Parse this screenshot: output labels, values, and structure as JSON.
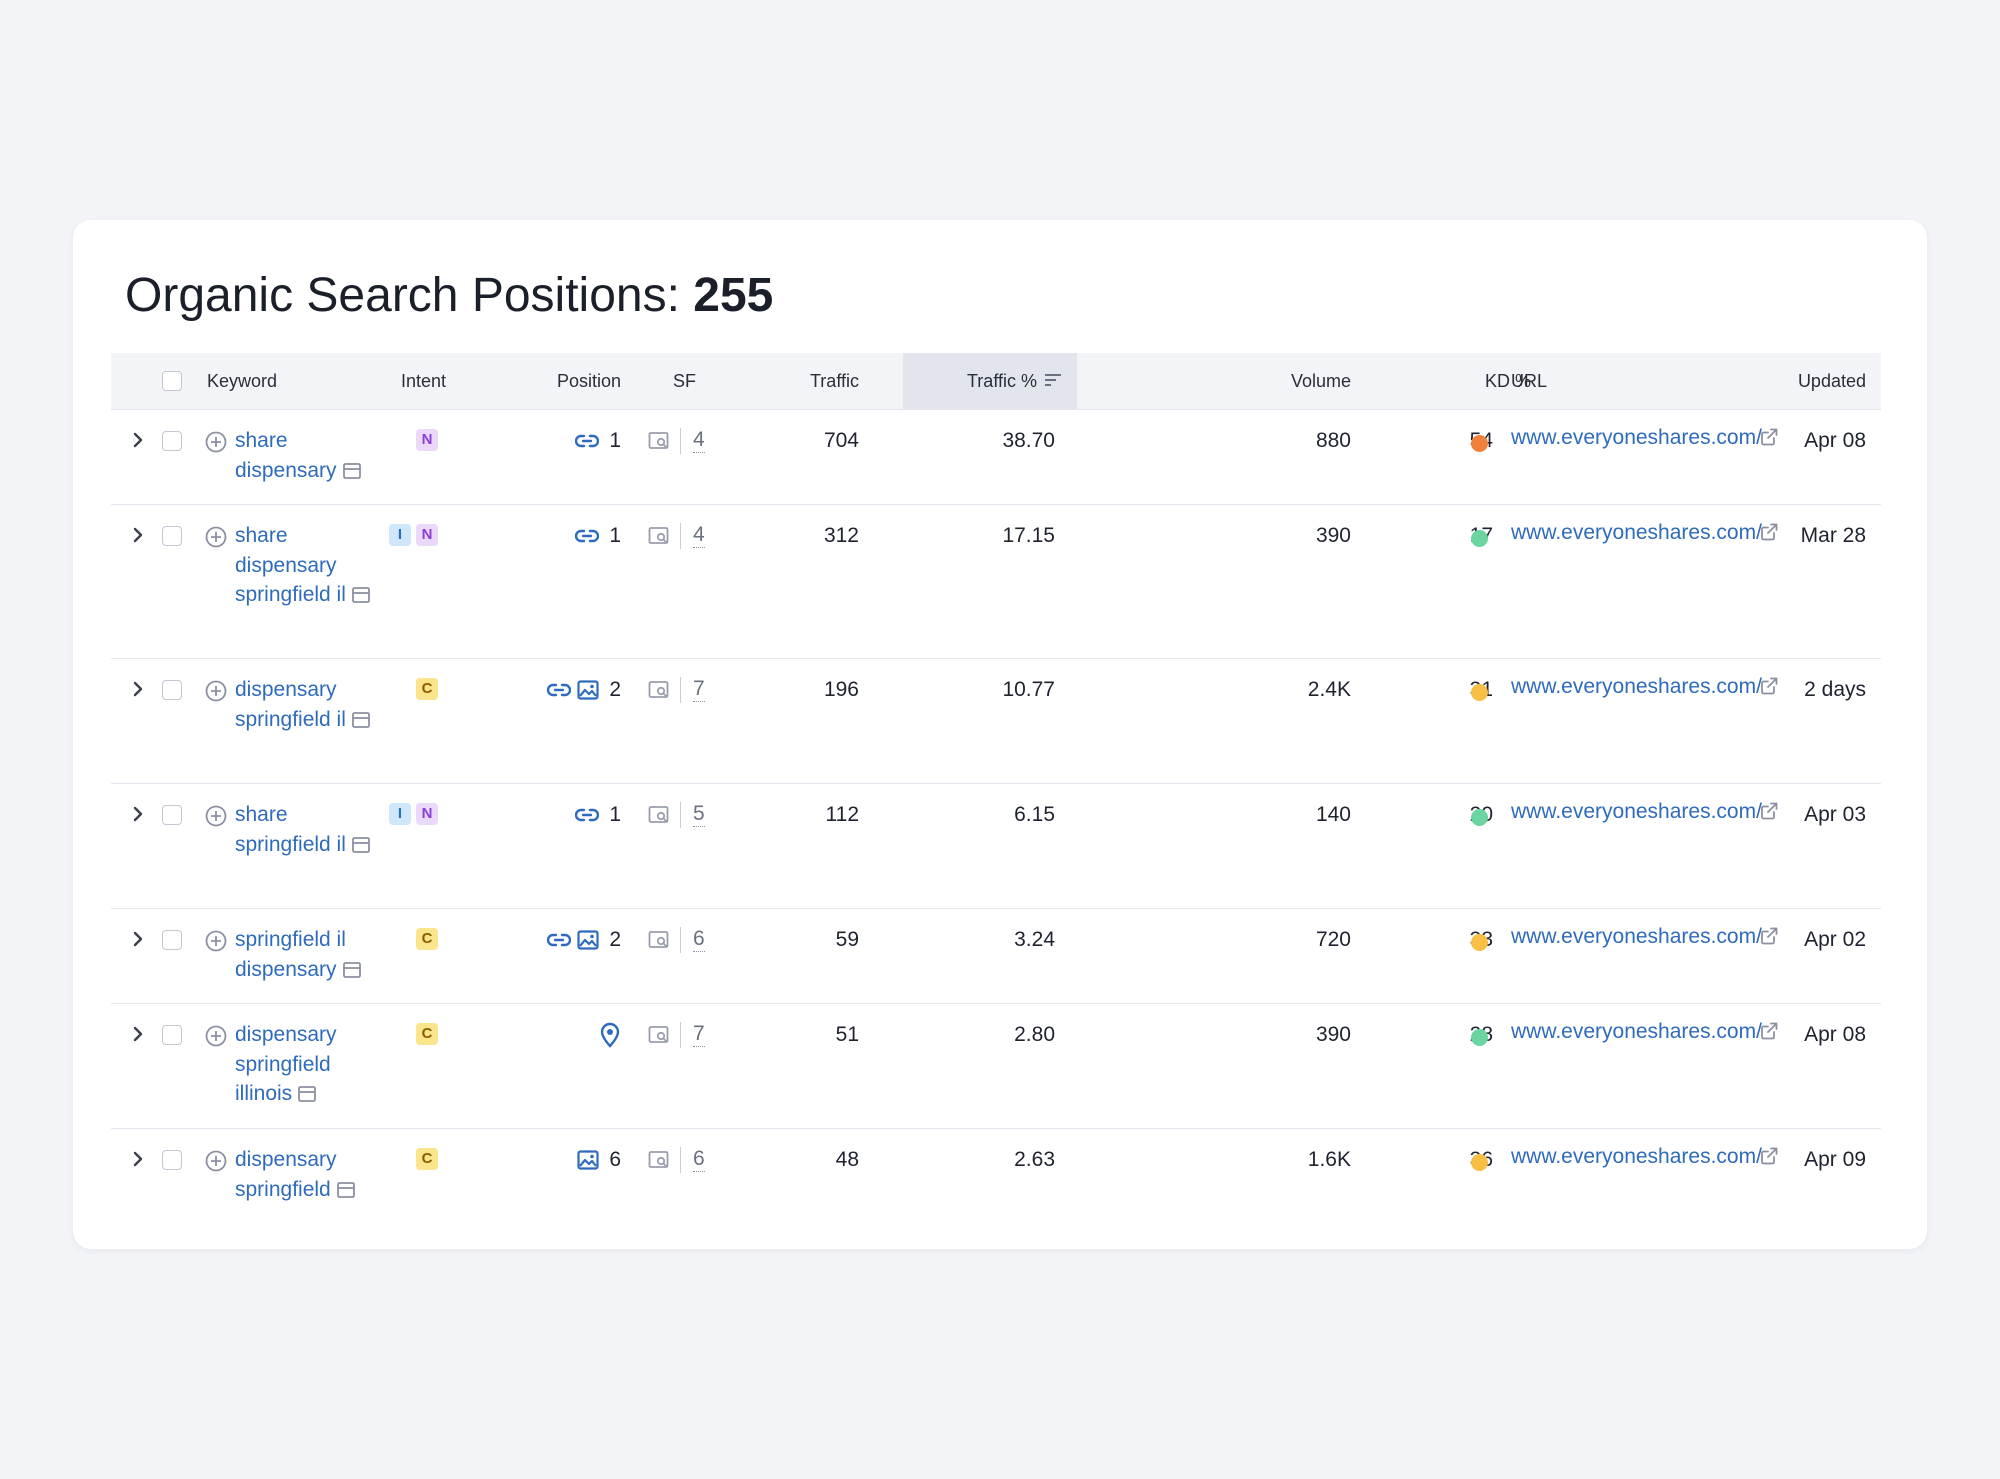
{
  "title": {
    "text": "Organic Search Positions: ",
    "count": "255"
  },
  "columns": {
    "keyword": "Keyword",
    "intent": "Intent",
    "position": "Position",
    "sf": "SF",
    "traffic": "Traffic",
    "traffic_pct": "Traffic %",
    "volume": "Volume",
    "kd": "KD %",
    "url": "URL",
    "updated": "Updated"
  },
  "kd_colors": {
    "orange": "#f0803c",
    "green": "#6ad5a0",
    "yellow": "#f7c044"
  },
  "rows": [
    {
      "keyword": "share dispensary",
      "intent": [
        "N"
      ],
      "position_icons": [
        "link-icon"
      ],
      "position": "1",
      "sf": "4",
      "traffic": "704",
      "traffic_pct": "38.70",
      "volume": "880",
      "kd": "54",
      "kd_color": "#f0803c",
      "url": "www.everyoneshares.com/",
      "updated": "Apr 08"
    },
    {
      "keyword": "share dispensary springfield il",
      "intent": [
        "I",
        "N"
      ],
      "position_icons": [
        "link-icon"
      ],
      "position": "1",
      "sf": "4",
      "traffic": "312",
      "traffic_pct": "17.15",
      "volume": "390",
      "kd": "17",
      "kd_color": "#6ad5a0",
      "url": "www.everyoneshares.com/",
      "updated": "Mar 28"
    },
    {
      "keyword": "dispensary springfield il",
      "intent": [
        "C"
      ],
      "position_icons": [
        "link-icon",
        "image-icon"
      ],
      "position": "2",
      "sf": "7",
      "traffic": "196",
      "traffic_pct": "10.77",
      "volume": "2.4K",
      "kd": "31",
      "kd_color": "#f7c044",
      "url": "www.everyoneshares.com/",
      "updated": "2 days"
    },
    {
      "keyword": "share springfield il",
      "intent": [
        "I",
        "N"
      ],
      "position_icons": [
        "link-icon"
      ],
      "position": "1",
      "sf": "5",
      "traffic": "112",
      "traffic_pct": "6.15",
      "volume": "140",
      "kd": "20",
      "kd_color": "#6ad5a0",
      "url": "www.everyoneshares.com/",
      "updated": "Apr 03"
    },
    {
      "keyword": "springfield il dispensary",
      "intent": [
        "C"
      ],
      "position_icons": [
        "link-icon",
        "image-icon"
      ],
      "position": "2",
      "sf": "6",
      "traffic": "59",
      "traffic_pct": "3.24",
      "volume": "720",
      "kd": "33",
      "kd_color": "#f7c044",
      "url": "www.everyoneshares.com/",
      "updated": "Apr 02"
    },
    {
      "keyword": "dispensary springfield illinois",
      "intent": [
        "C"
      ],
      "position_icons": [
        "map-pin-icon"
      ],
      "position": "",
      "sf": "7",
      "traffic": "51",
      "traffic_pct": "2.80",
      "volume": "390",
      "kd": "28",
      "kd_color": "#6ad5a0",
      "url": "www.everyoneshares.com/",
      "updated": "Apr 08"
    },
    {
      "keyword": "dispensary springfield",
      "intent": [
        "C"
      ],
      "position_icons": [
        "image-icon"
      ],
      "position": "6",
      "sf": "6",
      "traffic": "48",
      "traffic_pct": "2.63",
      "volume": "1.6K",
      "kd": "36",
      "kd_color": "#f7c044",
      "url": "www.everyoneshares.com/",
      "updated": "Apr 09"
    }
  ]
}
